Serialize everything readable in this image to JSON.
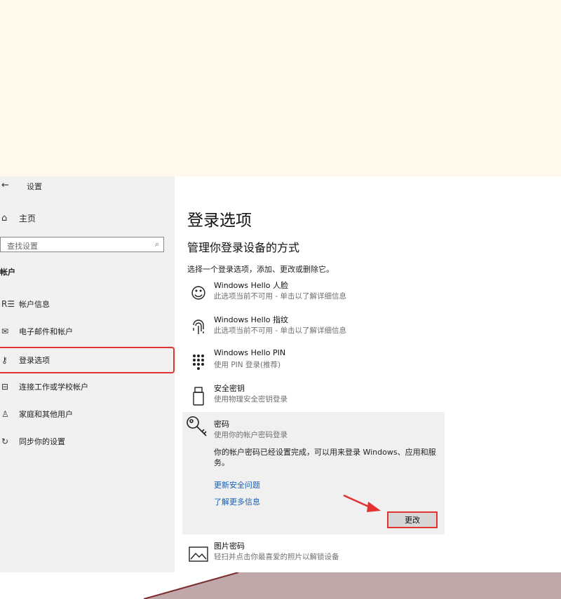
{
  "window": {
    "title": "设置",
    "back_icon": "back-arrow-icon"
  },
  "sidebar": {
    "home_label": "主页",
    "search_placeholder": "查找设置",
    "section_label": "帐户",
    "items": [
      {
        "label": "帐户信息",
        "icon": "person-card-icon"
      },
      {
        "label": "电子邮件和帐户",
        "icon": "mail-icon"
      },
      {
        "label": "登录选项",
        "icon": "key-icon",
        "active": true
      },
      {
        "label": "连接工作或学校帐户",
        "icon": "briefcase-icon"
      },
      {
        "label": "家庭和其他用户",
        "icon": "person-add-icon"
      },
      {
        "label": "同步你的设置",
        "icon": "sync-icon"
      }
    ]
  },
  "main": {
    "title": "登录选项",
    "subtitle": "管理你登录设备的方式",
    "description": "选择一个登录选项，添加、更改或删除它。",
    "options": [
      {
        "title": "Windows Hello 人脸",
        "subtitle": "此选项当前不可用 - 单击以了解详细信息",
        "icon": "face-icon"
      },
      {
        "title": "Windows Hello 指纹",
        "subtitle": "此选项当前不可用 - 单击以了解详细信息",
        "icon": "fingerprint-icon"
      },
      {
        "title": "Windows Hello PIN",
        "subtitle": "使用 PIN 登录(推荐)",
        "icon": "pin-keypad-icon"
      },
      {
        "title": "安全密钥",
        "subtitle": "使用物理安全密钥登录",
        "icon": "usb-key-icon"
      }
    ],
    "password": {
      "title": "密码",
      "subtitle": "使用你的帐户密码登录",
      "body": "你的帐户密码已经设置完成，可以用来登录 Windows、应用和服务。",
      "link1": "更新安全问题",
      "link2": "了解更多信息",
      "change_button": "更改",
      "icon": "key-icon"
    },
    "picture_password": {
      "title": "图片密码",
      "subtitle": "轻扫并点击你最喜爱的照片以解锁设备",
      "icon": "picture-icon"
    }
  },
  "colors": {
    "highlight": "#e23232",
    "link": "#1a5fb4",
    "sidebar_bg": "#f1f1f1",
    "cream_bg": "#fdf9ec",
    "footer": "#c0a7aa"
  }
}
